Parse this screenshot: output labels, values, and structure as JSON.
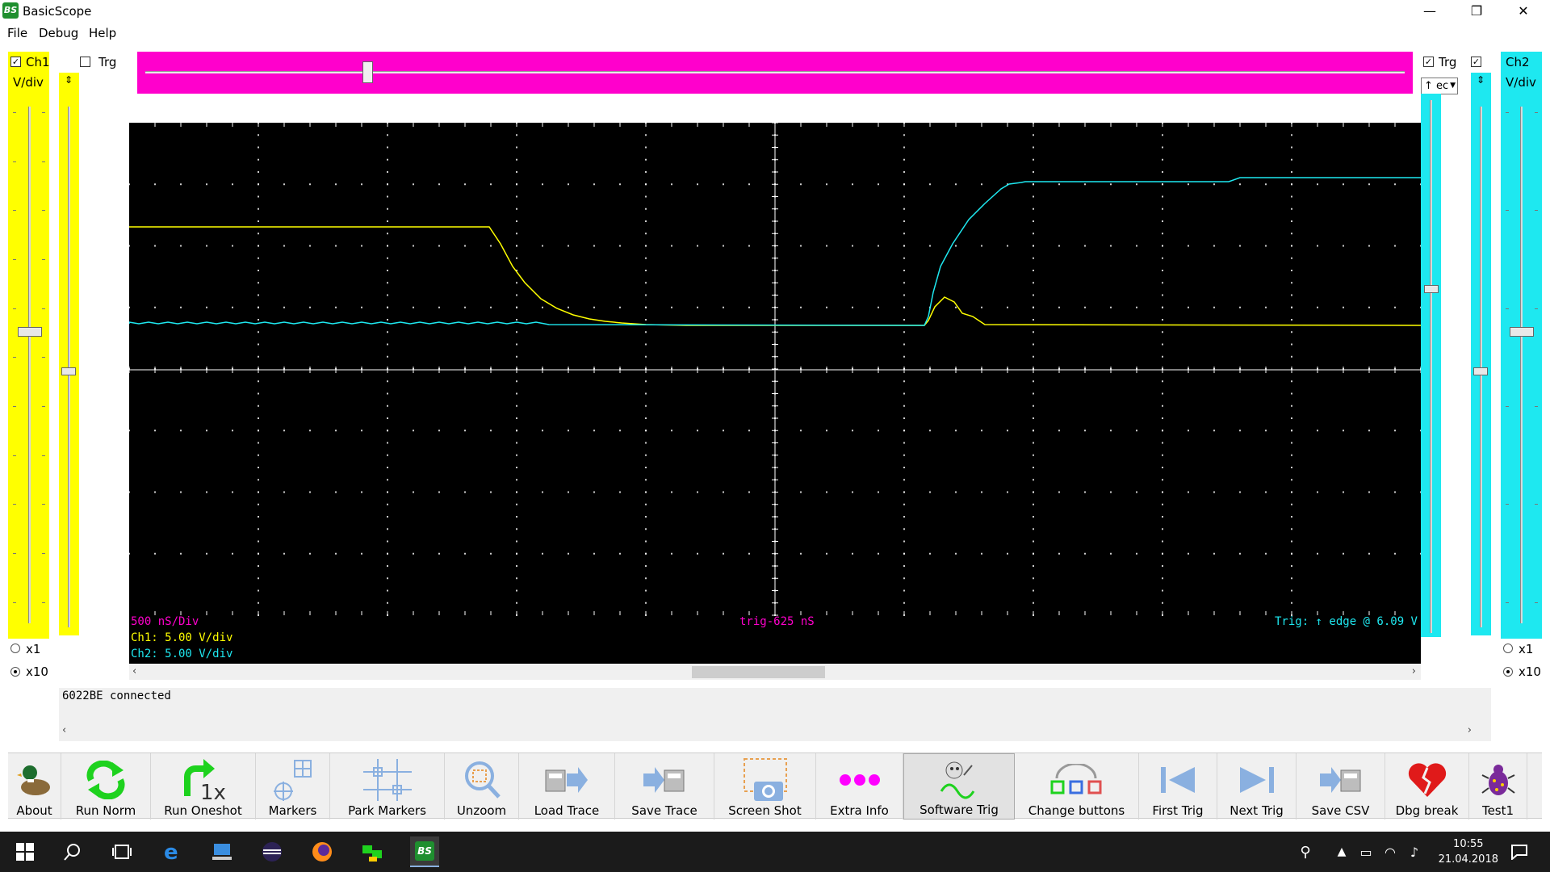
{
  "window": {
    "title": "BasicScope",
    "icon_text": "BS",
    "minimize": "—",
    "maximize": "❐",
    "close": "✕"
  },
  "menu": [
    "File",
    "Debug",
    "Help"
  ],
  "ch1": {
    "label": "Ch1",
    "trg_label": "Trg",
    "vdiv_label": "V/div",
    "x1": "x1",
    "x10": "x10",
    "color": "#ffff00"
  },
  "ch2": {
    "label": "Ch2",
    "trg_label": "Trg",
    "vdiv_label": "V/div",
    "edge_value": "↑ ec",
    "x1": "x1",
    "x10": "x10",
    "color": "#1ee8f0"
  },
  "scope": {
    "timebase": "500 nS/Div",
    "ch1_scale": "Ch1: 5.00 V/div",
    "ch2_scale": "Ch2: 5.00 V/div",
    "trigger_offset": "trig-625 nS",
    "trigger_info": "Trig: ↑ edge @ 6.09 V",
    "colors": {
      "timebase": "#ff00cc",
      "ch1": "#ffff00",
      "ch2": "#1ee8f0",
      "grid": "#ffffff"
    }
  },
  "scroll": {
    "left": "‹",
    "right": "›"
  },
  "status": {
    "message": "6022BE connected"
  },
  "toolbar": [
    {
      "label": "About",
      "icon": "duck-icon"
    },
    {
      "label": "Run Norm",
      "icon": "repeat-icon"
    },
    {
      "label": "Run Oneshot",
      "icon": "oneshot-icon"
    },
    {
      "label": "Markers",
      "icon": "markers-icon"
    },
    {
      "label": "Park Markers",
      "icon": "park-markers-icon"
    },
    {
      "label": "Unzoom",
      "icon": "magnifier-icon"
    },
    {
      "label": "Load Trace",
      "icon": "load-trace-icon"
    },
    {
      "label": "Save Trace",
      "icon": "save-trace-icon"
    },
    {
      "label": "Screen Shot",
      "icon": "camera-icon"
    },
    {
      "label": "Extra Info",
      "icon": "dots-icon"
    },
    {
      "label": "Software Trig",
      "icon": "software-trig-icon"
    },
    {
      "label": "Change buttons",
      "icon": "change-buttons-icon"
    },
    {
      "label": "First Trig",
      "icon": "first-trig-icon"
    },
    {
      "label": "Next Trig",
      "icon": "next-trig-icon"
    },
    {
      "label": "Save CSV",
      "icon": "save-csv-icon"
    },
    {
      "label": "Dbg break",
      "icon": "broken-heart-icon"
    },
    {
      "label": "Test1",
      "icon": "bug-icon"
    }
  ],
  "taskbar": {
    "time": "10:55",
    "date": "21.04.2018"
  }
}
